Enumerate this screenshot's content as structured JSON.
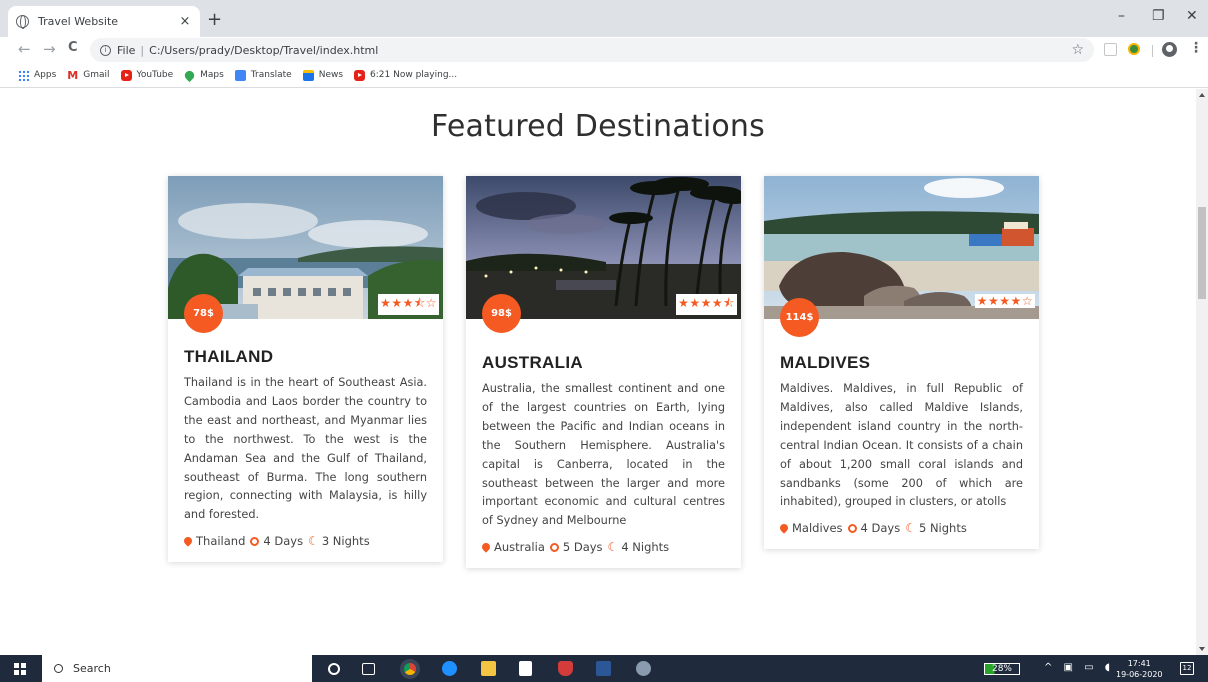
{
  "browser": {
    "tab_title": "Travel Website",
    "tab_close": "×",
    "new_tab": "+",
    "window_minimize": "–",
    "window_restore": "❐",
    "window_close": "✕",
    "back": "←",
    "forward": "→",
    "reload": "C",
    "url_scheme": "File",
    "url_path": "C:/Users/prady/Desktop/Travel/index.html",
    "bookmark_star": "☆",
    "menu": "⋮",
    "bookmarks": [
      {
        "label": "Apps",
        "icon": "apps-grid-icon"
      },
      {
        "label": "Gmail",
        "icon": "gmail-icon"
      },
      {
        "label": "YouTube",
        "icon": "youtube-icon"
      },
      {
        "label": "Maps",
        "icon": "maps-icon"
      },
      {
        "label": "Translate",
        "icon": "translate-icon"
      },
      {
        "label": "News",
        "icon": "news-icon"
      },
      {
        "label": "6:21 Now playing...",
        "icon": "youtube-icon"
      }
    ]
  },
  "page": {
    "heading": "Featured Destinations",
    "accent_color": "#f45a22",
    "cards": [
      {
        "price": "78$",
        "stars": "★★★⯪☆",
        "rating": 3.5,
        "name": "THAILAND",
        "description": "Thailand is in the heart of Southeast Asia. Cambodia and Laos border the country to the east and northeast, and Myanmar lies to the northwest. To the west is the Andaman Sea and the Gulf of Thailand, southeast of Burma. The long southern region, connecting with Malaysia, is hilly and forested.",
        "location": "Thailand",
        "days": "4 Days",
        "nights": "3 Nights"
      },
      {
        "price": "98$",
        "stars": "★★★★⯪",
        "rating": 4.5,
        "name": "AUSTRALIA",
        "description": "Australia, the smallest continent and one of the largest countries on Earth, lying between the Pacific and Indian oceans in the Southern Hemisphere. Australia's capital is Canberra, located in the southeast between the larger and more important economic and cultural centres of Sydney and Melbourne",
        "location": "Australia",
        "days": "5 Days",
        "nights": "4 Nights"
      },
      {
        "price": "114$",
        "stars": "★★★★☆",
        "rating": 4,
        "name": "MALDIVES",
        "description": "Maldives. Maldives, in full Republic of Maldives, also called Maldive Islands, independent island country in the north-central Indian Ocean. It consists of a chain of about 1,200 small coral islands and sandbanks (some 200 of which are inhabited), grouped in clusters, or atolls",
        "location": "Maldives",
        "days": "4 Days",
        "nights": "5 Nights"
      }
    ]
  },
  "taskbar": {
    "search_label": "Search",
    "battery": "28%",
    "battery_level": 0.28,
    "time": "17:41",
    "date": "19-06-2020",
    "notifications": "12"
  }
}
